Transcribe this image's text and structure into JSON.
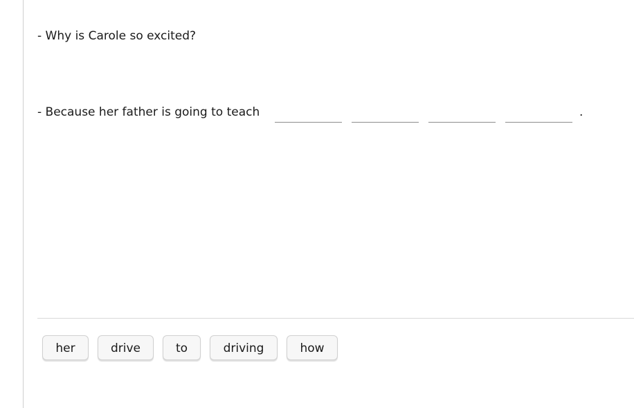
{
  "exercise": {
    "question": "- Why is Carole so excited?",
    "answer_prefix": "- Because her father is going to teach",
    "answer_suffix": ".",
    "blanks": [
      "",
      "",
      "",
      ""
    ]
  },
  "word_bank": {
    "words": [
      "her",
      "drive",
      "to",
      "driving",
      "how"
    ]
  }
}
